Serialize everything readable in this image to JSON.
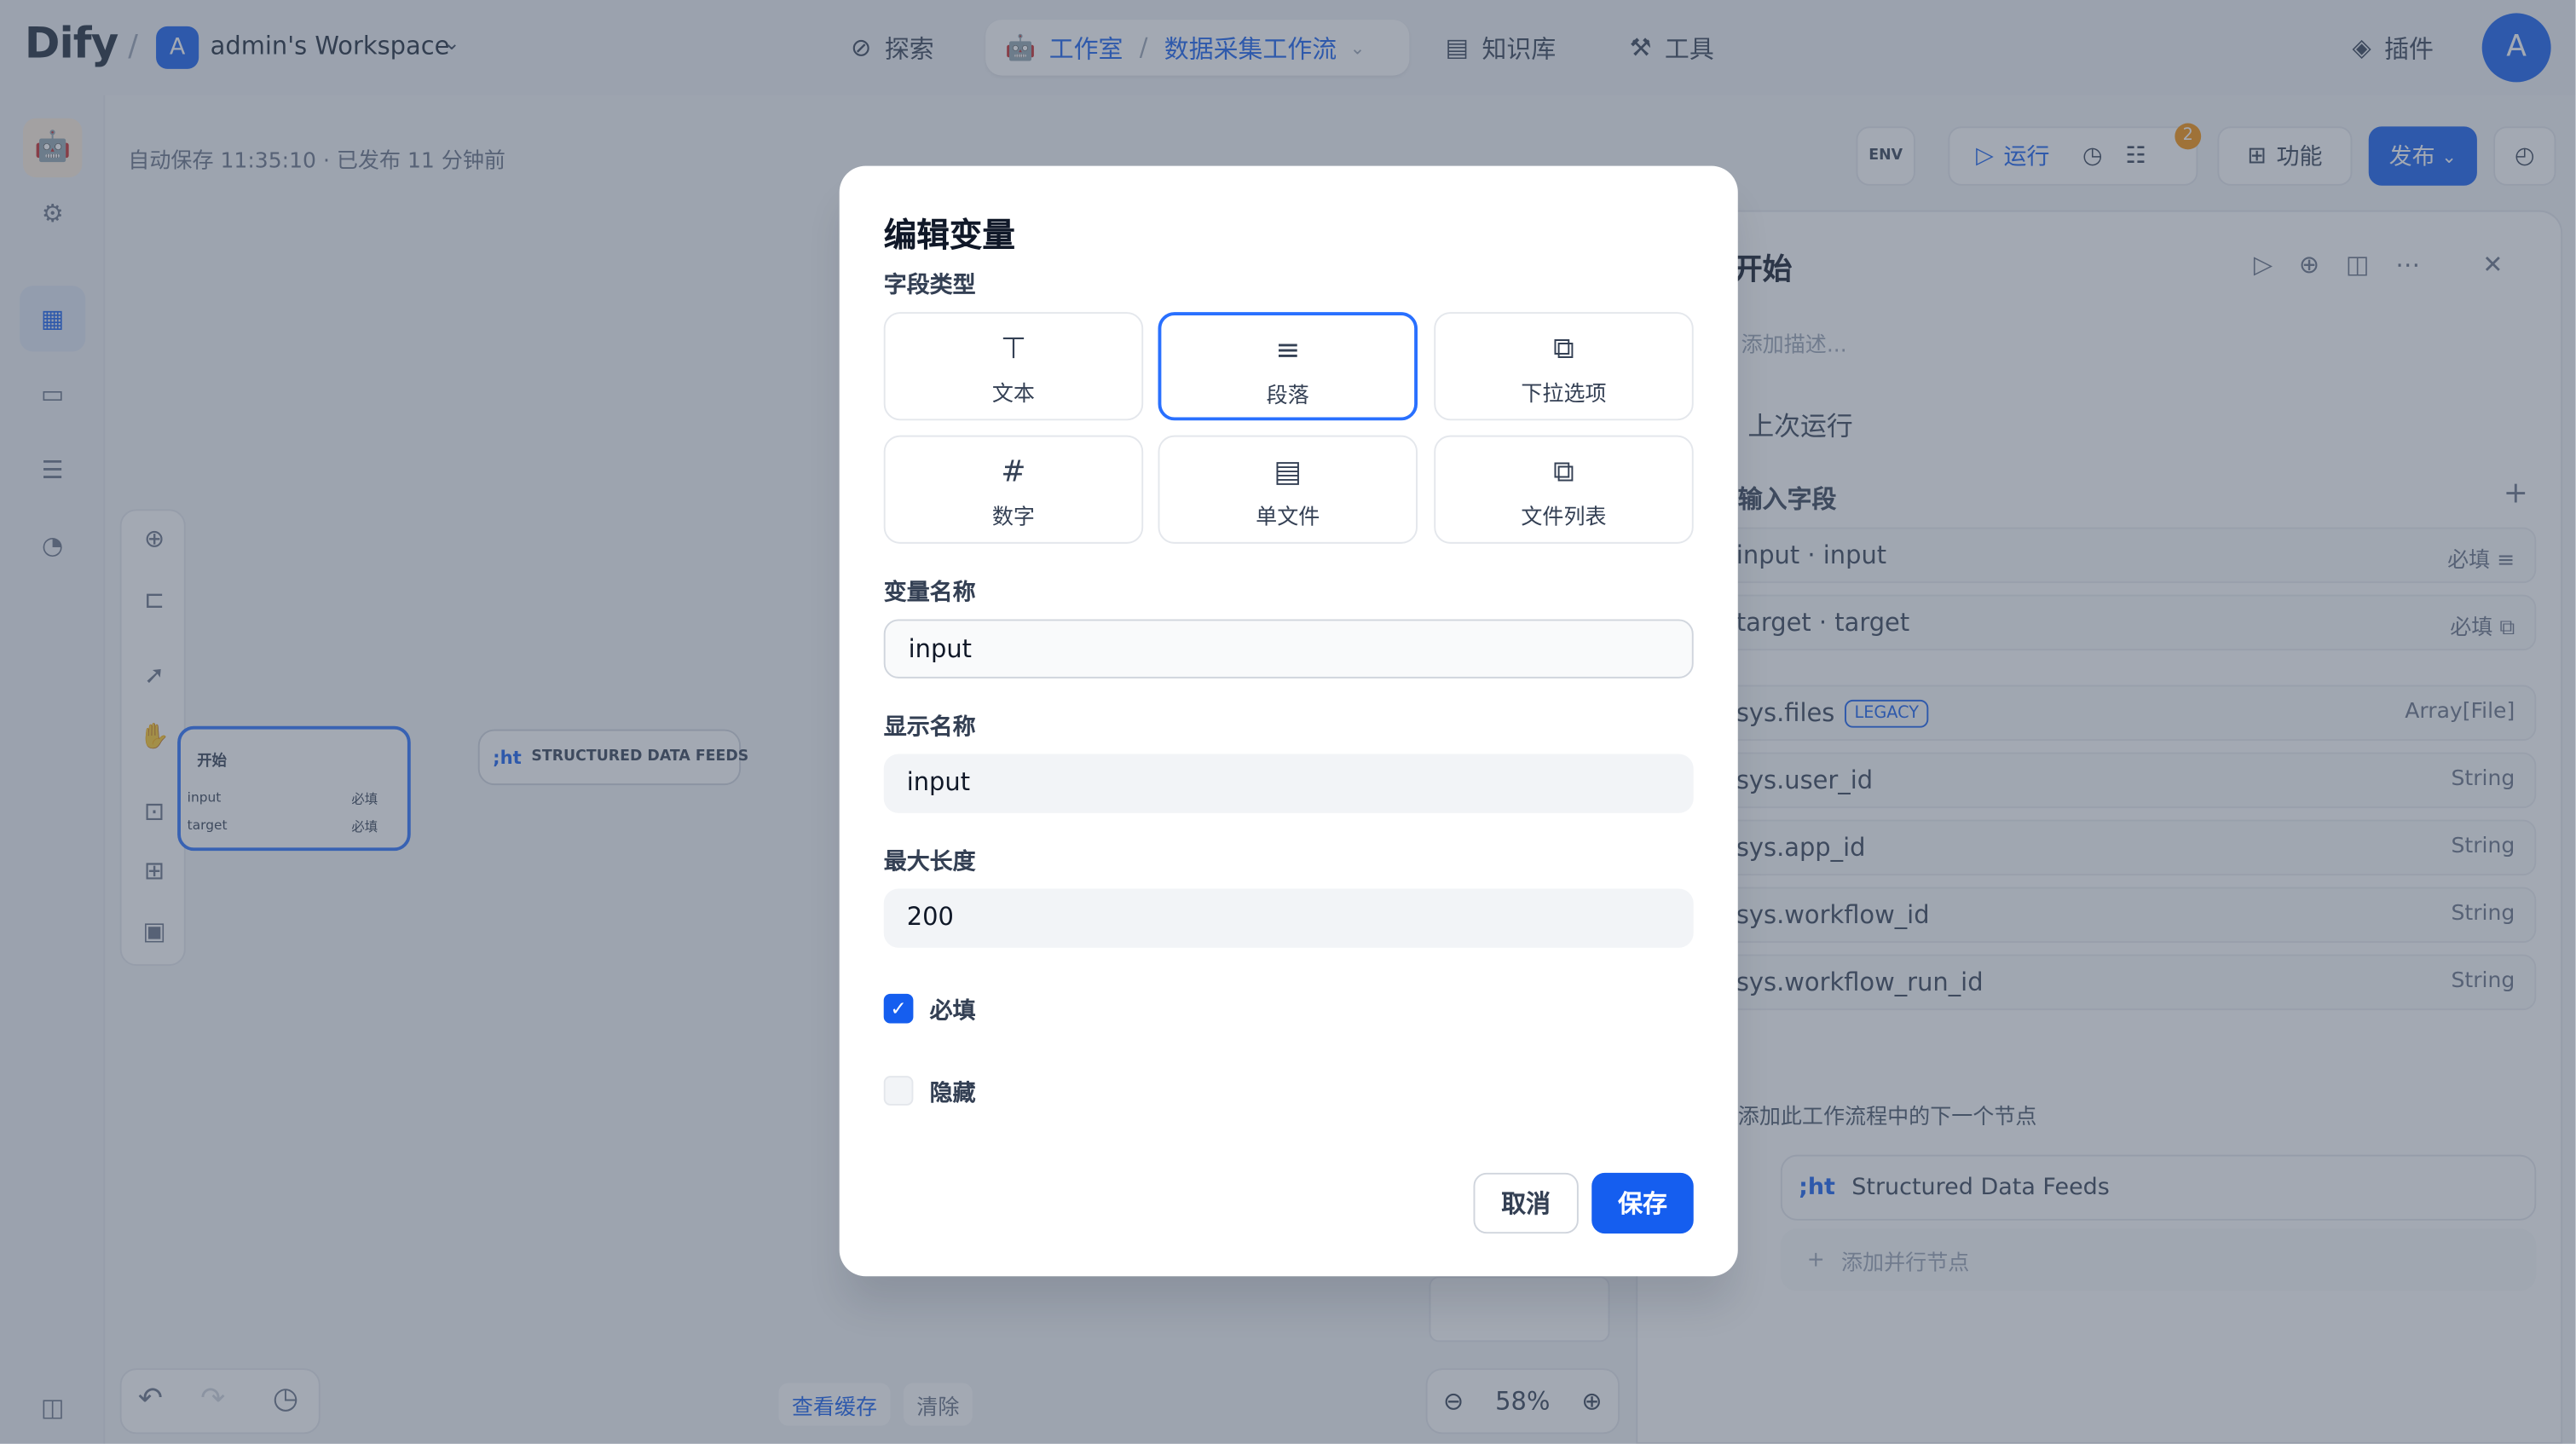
{
  "header": {
    "logo": "Dify",
    "workspace_avatar": "A",
    "workspace_name": "admin's Workspace",
    "nav": {
      "explore": "探索",
      "studio": "工作室",
      "workflow": "数据采集工作流",
      "knowledge": "知识库",
      "tools": "工具",
      "plugins": "插件"
    },
    "user_avatar": "A"
  },
  "canvas": {
    "autosave": "自动保存 11:35:10 · 已发布 11 分钟前",
    "toolbar": {
      "env": "ENV",
      "run": "运行",
      "badge": "2",
      "features": "功能",
      "publish": "发布"
    },
    "start_node": {
      "title": "开始",
      "row1": "input",
      "row1_tag": "必填",
      "row2": "target",
      "row2_tag": "必填"
    },
    "sdf_node": "STRUCTURED DATA FEEDS",
    "cache": {
      "view": "查看缓存",
      "clear": "清除"
    },
    "zoom": "58%"
  },
  "panel": {
    "title": "开始",
    "description": "添加描述...",
    "last_run": "上次运行",
    "section": "输入字段",
    "rows": [
      {
        "label": "input · input",
        "right": "必填"
      },
      {
        "label": "target · target",
        "right": "必填"
      },
      {
        "label": "sys.files",
        "legacy": "LEGACY",
        "right": "Array[File]"
      },
      {
        "label": "sys.user_id",
        "right": "String"
      },
      {
        "label": "sys.app_id",
        "right": "String"
      },
      {
        "label": "sys.workflow_id",
        "right": "String"
      },
      {
        "label": "sys.workflow_run_id",
        "right": "String"
      }
    ],
    "next_label": "添加此工作流程中的下一个节点",
    "next_node": "Structured Data Feeds",
    "add_parallel": "添加并行节点"
  },
  "modal": {
    "title": "编辑变量",
    "field_type_label": "字段类型",
    "types": [
      {
        "label": "文本"
      },
      {
        "label": "段落"
      },
      {
        "label": "下拉选项"
      },
      {
        "label": "数字"
      },
      {
        "label": "单文件"
      },
      {
        "label": "文件列表"
      }
    ],
    "selected_type": "段落",
    "var_name_label": "变量名称",
    "var_name_value": "input",
    "display_name_label": "显示名称",
    "display_name_value": "input",
    "max_length_label": "最大长度",
    "max_length_value": "200",
    "required_label": "必填",
    "required_checked": true,
    "hidden_label": "隐藏",
    "hidden_checked": false,
    "cancel": "取消",
    "save": "保存"
  },
  "colors": {
    "accent": "#155eef",
    "selected_border": "#2970ff",
    "overlay": "#475467"
  }
}
